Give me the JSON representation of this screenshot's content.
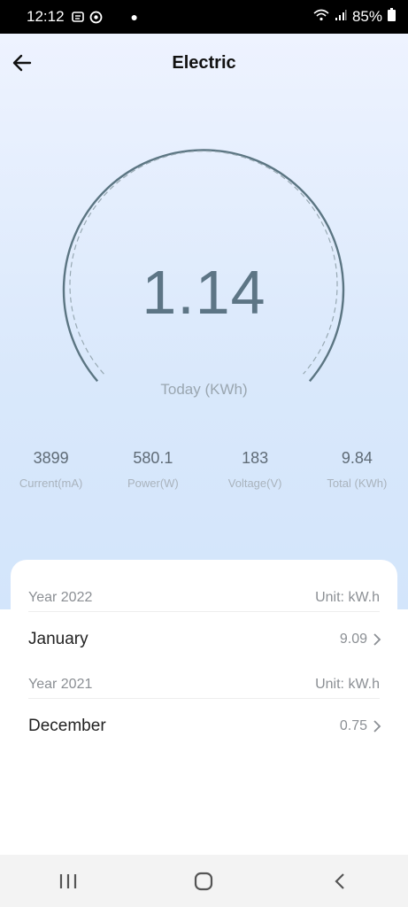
{
  "status_bar": {
    "time": "12:12",
    "battery": "85%"
  },
  "header": {
    "title": "Electric"
  },
  "gauge": {
    "value": "1.14",
    "label": "Today (KWh)"
  },
  "stats": [
    {
      "value": "3899",
      "label": "Current(mA)"
    },
    {
      "value": "580.1",
      "label": "Power(W)"
    },
    {
      "value": "183",
      "label": "Voltage(V)"
    },
    {
      "value": "9.84",
      "label": "Total (KWh)"
    }
  ],
  "history": [
    {
      "year": "Year 2022",
      "unit": "Unit: kW.h",
      "month": "January",
      "value": "9.09"
    },
    {
      "year": "Year 2021",
      "unit": "Unit: kW.h",
      "month": "December",
      "value": "0.75"
    }
  ],
  "colors": {
    "gauge_stroke": "#5b7582",
    "background_top": "#eef3ff",
    "background_bottom": "#d3e5fb"
  }
}
